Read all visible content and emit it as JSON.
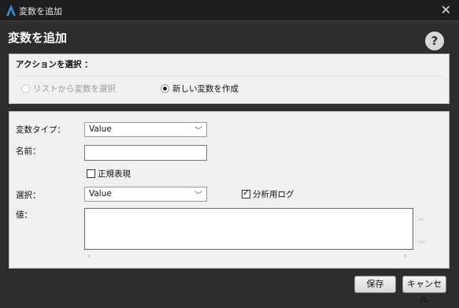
{
  "window": {
    "title": "変数を追加",
    "close": "✕"
  },
  "header": {
    "title": "変数を追加",
    "help": "?"
  },
  "action": {
    "title": "アクションを選択 ：",
    "radio_list": "リストから変数を選択",
    "radio_new": "新しい変数を作成",
    "selected": "new"
  },
  "form": {
    "type_label": "変数タイプ：",
    "type_value": "Value",
    "name_label": "名前：",
    "name_value": "",
    "regex_label": "正規表現",
    "regex_checked": false,
    "select_label": "選択：",
    "select_value": "Value",
    "log_label": "分析用ログ",
    "log_checked": true,
    "value_label": "値：",
    "value_text": ""
  },
  "buttons": {
    "save": "保存",
    "cancel": "キャンセル"
  },
  "icons": {
    "app": "app-logo-icon",
    "close": "close-icon",
    "help": "help-icon",
    "chevron": "chevron-down-icon"
  }
}
